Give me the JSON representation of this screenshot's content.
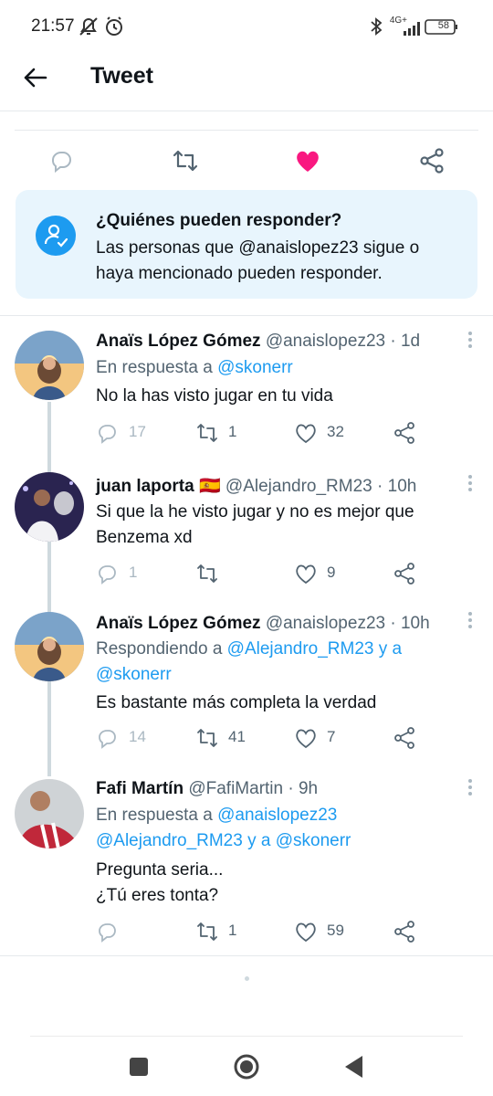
{
  "status_bar": {
    "time": "21:57",
    "network": "4G+",
    "battery": "58"
  },
  "header": {
    "title": "Tweet"
  },
  "reply_card": {
    "title": "¿Quiénes pueden responder?",
    "text": "Las personas que @anaislopez23 sigue o haya mencionado pueden responder."
  },
  "colors": {
    "accent": "#1d9bf0",
    "like": "#f91880",
    "muted": "#536471"
  },
  "tweets": [
    {
      "name": "Anaïs López Gómez",
      "handle": "@anaislopez23",
      "time": "· 1d",
      "context_prefix": "En respuesta a",
      "context_mention": "@skonerr",
      "text": "No la has visto jugar en tu vida",
      "replies": "17",
      "retweets": "1",
      "likes": "32"
    },
    {
      "name": "juan laporta",
      "flag": "🇪🇸",
      "handle": "@Alejandro_RM23",
      "time": "· 10h",
      "text_1": "Si que la he visto jugar y no es mejor que",
      "text_2": "Benzema xd",
      "replies": "1",
      "retweets": "",
      "likes": "9"
    },
    {
      "name": "Anaïs López Gómez",
      "handle": "@anaislopez23",
      "time": "· 10h",
      "context_prefix": "Respondiendo a",
      "context_line1": "@Alejandro_RM23 y a",
      "context_line2": "@skonerr",
      "text": "Es bastante más completa la verdad",
      "replies": "14",
      "retweets": "41",
      "likes": "7"
    },
    {
      "name": "Fafi Martín",
      "handle": "@FafiMartin",
      "time": "· 9h",
      "context_prefix": "En respuesta a",
      "context_line1": "@anaislopez23",
      "context_line2": "@Alejandro_RM23 y a @skonerr",
      "text_1": "Pregunta seria...",
      "text_2": "¿Tú eres tonta?",
      "replies": "",
      "retweets": "1",
      "likes": "59"
    }
  ]
}
